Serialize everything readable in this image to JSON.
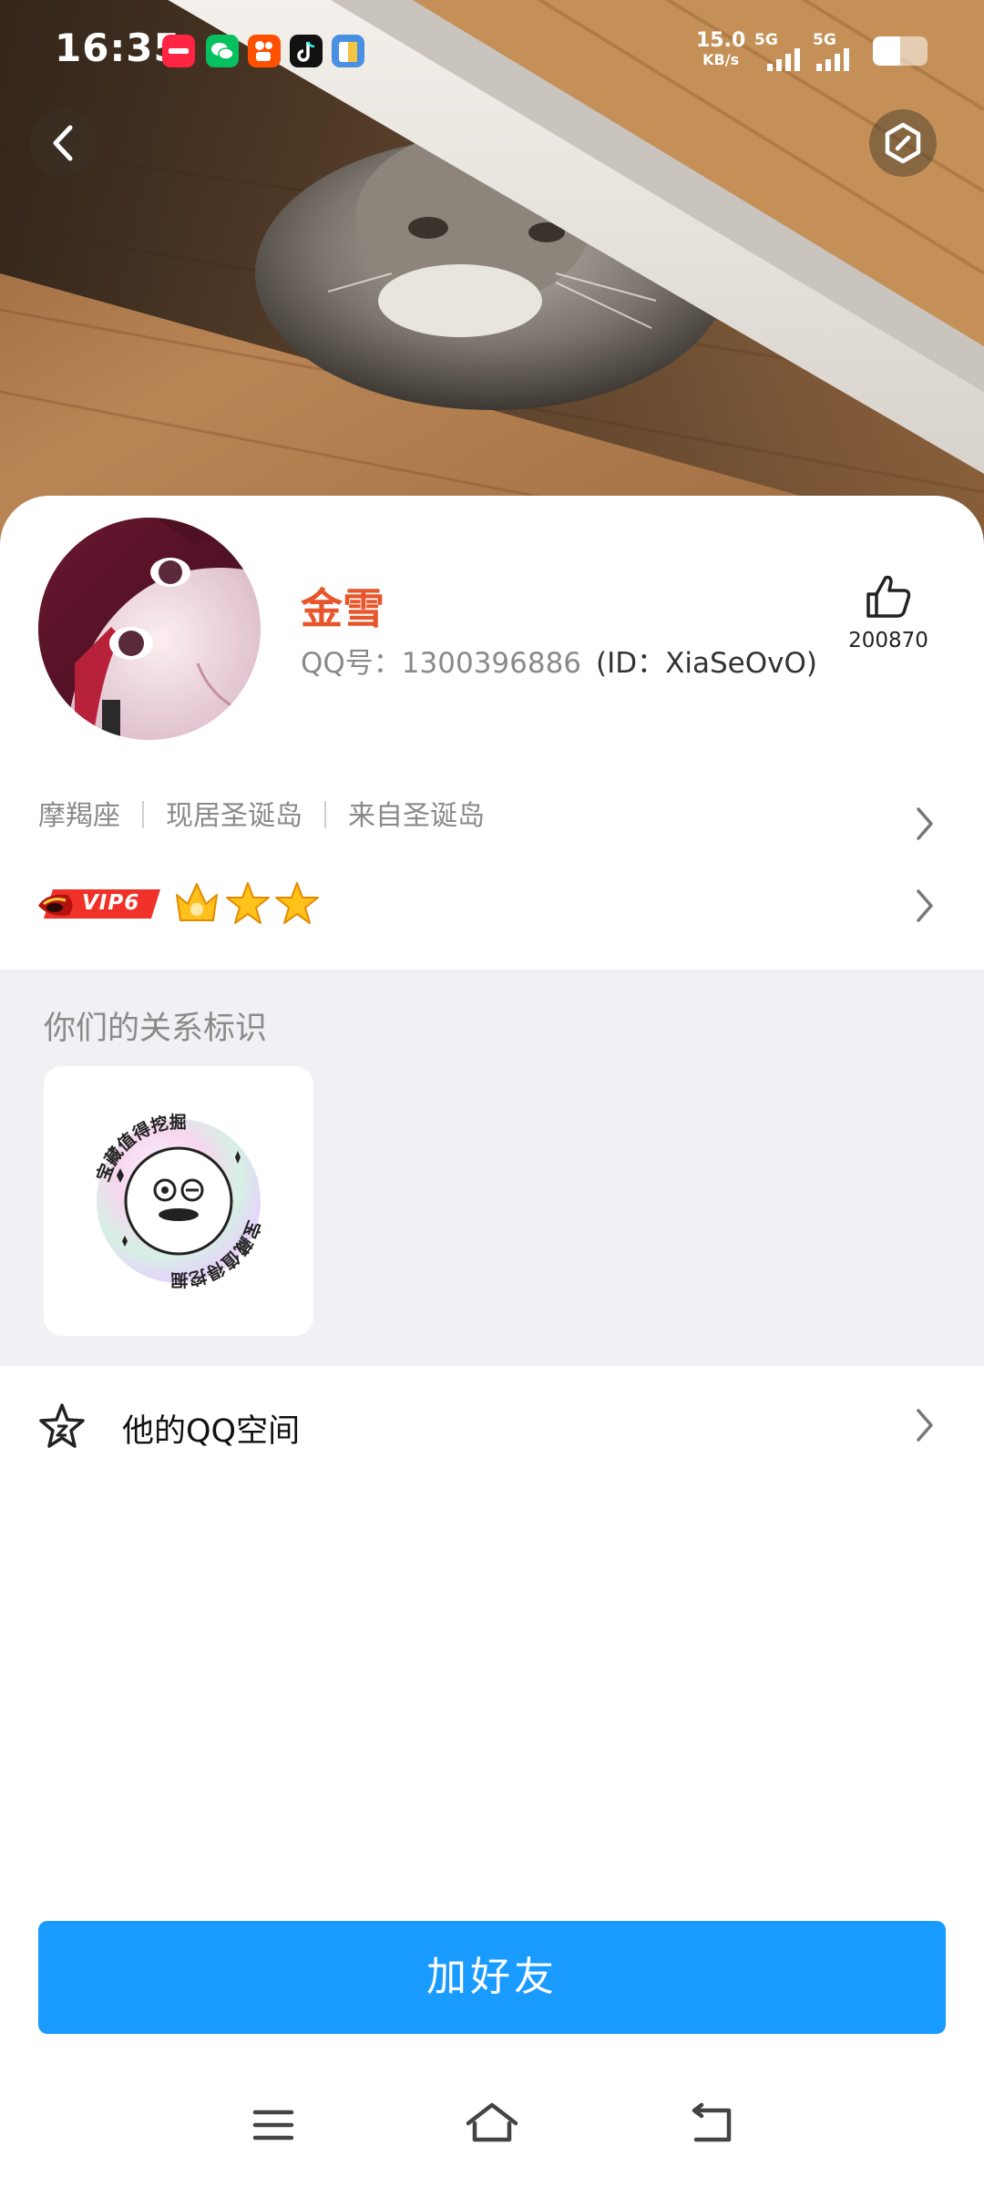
{
  "status_bar": {
    "time": "16:35",
    "apps": [
      {
        "icon": "xiaohongshu-icon",
        "color": "#ff2442"
      },
      {
        "icon": "wechat-icon",
        "color": "#07c160"
      },
      {
        "icon": "kuaishou-icon",
        "color": "#ff5000"
      },
      {
        "icon": "tiktok-icon",
        "color": "#111111"
      },
      {
        "icon": "files-icon",
        "color": "#4a90e2"
      }
    ],
    "net_speed_value": "15.0",
    "net_speed_unit": "KB/s",
    "signal_1": "5G",
    "signal_2": "5G",
    "battery_level": 0.5
  },
  "header": {
    "back_icon": "chevron-left-icon",
    "menu_icon": "hexagon-slash-icon"
  },
  "profile": {
    "name": "金雪",
    "qq_label": "QQ号：1300396886",
    "id_label": "(ID：XiaSeOvO)",
    "like_count": "200870",
    "like_icon": "thumbs-up-icon"
  },
  "info": {
    "zodiac": "摩羯座",
    "current_location": "现居圣诞岛",
    "hometown": "来自圣诞岛"
  },
  "badges": {
    "vip_label": "VIP6",
    "icons": [
      "crown-icon",
      "star-icon",
      "star-icon"
    ]
  },
  "relation": {
    "title": "你们的关系标识",
    "badge_text": "宝藏值得挖掘"
  },
  "qzone": {
    "label": "他的QQ空间",
    "icon": "star-outline-icon"
  },
  "actions": {
    "add_friend": "加好友"
  },
  "nav": {
    "icons": [
      "menu-icon",
      "home-icon",
      "back-icon"
    ]
  },
  "colors": {
    "accent": "#1a9bff",
    "name": "#e8552a",
    "section_bg": "#f1f1f5"
  }
}
